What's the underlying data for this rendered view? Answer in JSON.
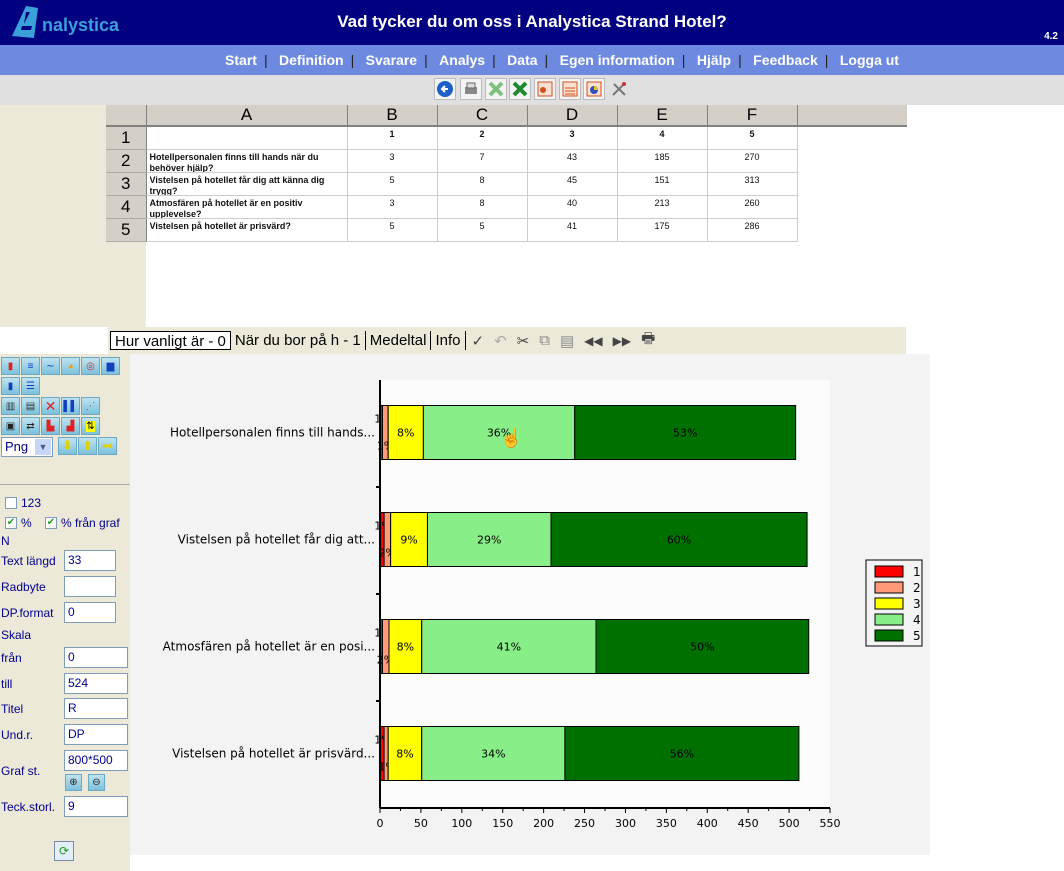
{
  "header": {
    "logo_text": "nalystica",
    "title": "Vad tycker du om oss i Analystica Strand Hotel?",
    "version": "4.2"
  },
  "nav": {
    "items": [
      "Start",
      "Definition",
      "Svarare",
      "Analys",
      "Data",
      "Egen information",
      "Hjälp",
      "Feedback",
      "Logga ut"
    ]
  },
  "toolbar": {
    "icons": [
      "back-icon",
      "print-icon",
      "excel-light-icon",
      "excel-icon",
      "powerpoint-chart-icon",
      "powerpoint-table-icon",
      "powerpoint-pie-icon",
      "tools-icon"
    ]
  },
  "sheet": {
    "columns": [
      "A",
      "B",
      "C",
      "D",
      "E",
      "F"
    ],
    "rows": [
      {
        "num": "1",
        "a": "",
        "values": [
          "1",
          "2",
          "3",
          "4",
          "5"
        ]
      },
      {
        "num": "2",
        "a": "Hotellpersonalen finns till hands när du behöver hjälp?",
        "values": [
          "3",
          "7",
          "43",
          "185",
          "270"
        ]
      },
      {
        "num": "3",
        "a": "Vistelsen på hotellet får dig att känna dig trygg?",
        "values": [
          "5",
          "8",
          "45",
          "151",
          "313"
        ]
      },
      {
        "num": "4",
        "a": "Atmosfären på hotellet är en positiv upplevelse?",
        "values": [
          "3",
          "8",
          "40",
          "213",
          "260"
        ]
      },
      {
        "num": "5",
        "a": "Vistelsen på hotellet är prisvärd?",
        "values": [
          "5",
          "5",
          "41",
          "175",
          "286"
        ]
      }
    ]
  },
  "tabs": {
    "items": [
      "Hur vanligt är - 0",
      "När du bor på h - 1",
      "Medeltal",
      "Info"
    ],
    "active": 0,
    "tools": [
      "check-icon",
      "undo-icon",
      "cut-icon",
      "copy-icon",
      "paste-icon",
      "rewind-icon",
      "forward-icon",
      "print-icon"
    ]
  },
  "panel": {
    "format_select": "Png",
    "cb_123": {
      "label": "123",
      "checked": false
    },
    "cb_pct": {
      "label": "%",
      "checked": true
    },
    "cb_pct_graf": {
      "label": "% från graf",
      "checked": true
    },
    "n_label": "N",
    "text_langd": {
      "label": "Text längd",
      "value": "33"
    },
    "radbyte": {
      "label": "Radbyte",
      "value": ""
    },
    "dp_format": {
      "label": "DP.format",
      "value": "0"
    },
    "skala_label": "Skala",
    "fran": {
      "label": "från",
      "value": "0"
    },
    "till": {
      "label": "till",
      "value": "524"
    },
    "titel": {
      "label": "Titel",
      "value": "R"
    },
    "undr": {
      "label": "Und.r.",
      "value": "DP"
    },
    "graf_st": {
      "label": "Graf st.",
      "value": "800*500"
    },
    "teck_storl": {
      "label": "Teck.storl.",
      "value": "9"
    }
  },
  "chart_data": {
    "type": "bar",
    "orientation": "horizontal",
    "stacked": true,
    "categories": [
      "Hotellpersonalen finns till hands...",
      "Vistelsen på hotellet får dig att...",
      "Atmosfären på hotellet är en posi...",
      "Vistelsen på hotellet är prisvärd..."
    ],
    "series": [
      {
        "name": "1",
        "color": "#ff0000",
        "values": [
          3,
          5,
          3,
          5
        ],
        "labels": [
          "1%",
          "1%",
          "1%",
          "1%"
        ]
      },
      {
        "name": "2",
        "color": "#ff9977",
        "values": [
          7,
          8,
          8,
          5
        ],
        "labels": [
          "1%",
          "2%",
          "2%",
          "1%"
        ]
      },
      {
        "name": "3",
        "color": "#ffff00",
        "values": [
          43,
          45,
          40,
          41
        ],
        "labels": [
          "8%",
          "9%",
          "8%",
          "8%"
        ]
      },
      {
        "name": "4",
        "color": "#88ee88",
        "values": [
          185,
          151,
          213,
          175
        ],
        "labels": [
          "36%",
          "29%",
          "41%",
          "34%"
        ]
      },
      {
        "name": "5",
        "color": "#007000",
        "values": [
          270,
          313,
          260,
          286
        ],
        "labels": [
          "53%",
          "60%",
          "50%",
          "56%"
        ]
      }
    ],
    "xlim": [
      0,
      550
    ],
    "xticks": [
      0,
      50,
      100,
      150,
      200,
      250,
      300,
      350,
      400,
      450,
      500,
      550
    ],
    "legend_position": "right",
    "title": "",
    "xlabel": "",
    "ylabel": ""
  }
}
